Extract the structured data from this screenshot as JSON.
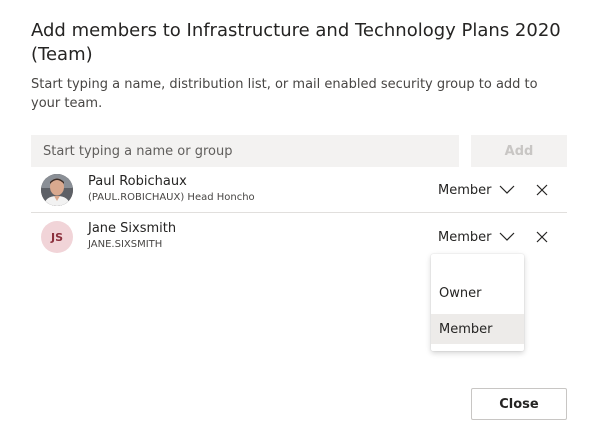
{
  "dialog": {
    "title": "Add members to Infrastructure and Technology Plans 2020 (Team)",
    "subtitle": "Start typing a name, distribution list, or mail enabled security group to add to your team."
  },
  "search": {
    "placeholder": "Start typing a name or group",
    "value": ""
  },
  "add_button": {
    "label": "Add"
  },
  "members": [
    {
      "name": "Paul Robichaux",
      "detail": "(PAUL.ROBICHAUX) Head Honcho",
      "role": "Member",
      "avatar": "photo"
    },
    {
      "name": "Jane Sixsmith",
      "detail": "JANE.SIXSMITH",
      "role": "Member",
      "initials": "JS"
    }
  ],
  "role_menu": {
    "options": [
      "Owner",
      "Member"
    ],
    "selected": "Member"
  },
  "close_button": {
    "label": "Close"
  },
  "icons": {
    "chevron": "chevron-down-icon",
    "remove": "close-icon"
  }
}
